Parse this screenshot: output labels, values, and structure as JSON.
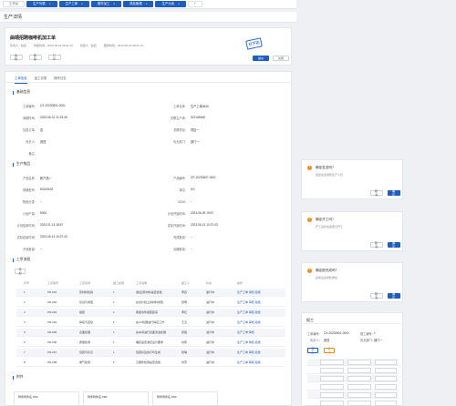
{
  "tabs": [
    {
      "label": "工作台",
      "active": false
    },
    {
      "label": "生产列表",
      "active": true
    },
    {
      "label": "生产工单",
      "active": true
    },
    {
      "label": "委外加工",
      "active": true
    },
    {
      "label": "质检管理",
      "active": true
    },
    {
      "label": "生产计划",
      "active": true
    }
  ],
  "tab_close": "×",
  "page_title": "生产详情",
  "header": {
    "title": "曲靖招聘咖啡机加工单",
    "meta": [
      "负责人：赵四",
      "创建时间：2023-05-01 09:41:12",
      "创建人：赵四",
      "更新时间：2023-05-01 09:41:12"
    ],
    "buttons": {
      "edit": "编辑",
      "delete": "删除",
      "print": "打印"
    },
    "stamp": "已下达",
    "submit": "提交",
    "close": "关闭"
  },
  "subtabs": [
    "工单信息",
    "加工记录",
    "操作日志"
  ],
  "basic": {
    "title": "基础信息",
    "fields": [
      {
        "label": "工单编号：",
        "value": "CX-20230601-0001"
      },
      {
        "label": "工单名称：",
        "value": "生产工单0640"
      },
      {
        "label": "单据时间：",
        "value": "2023-06-01 21:23:45"
      },
      {
        "label": "关联生产单：",
        "value": "SCD45568"
      },
      {
        "label": "加急订单：",
        "value": "否"
      },
      {
        "label": "关联项目：",
        "value": "项目一"
      },
      {
        "label": "负责人：",
        "value": "张四"
      },
      {
        "label": "负责部门：",
        "value": "部门一"
      },
      {
        "label": "备注：",
        "value": ""
      }
    ]
  },
  "product": {
    "title": "生产物品",
    "fields": [
      {
        "label": "产品名称：",
        "value": "新产品一"
      },
      {
        "label": "产品编号：",
        "value": "CP-20230607-0001"
      },
      {
        "label": "规格型号：",
        "value": "60100192"
      },
      {
        "label": "单位：",
        "value": "KG"
      },
      {
        "label": "物品分类：",
        "value": "--"
      },
      {
        "label": "BOM：",
        "value": "--"
      },
      {
        "label": "计划产量：",
        "value": "5000"
      },
      {
        "label": "计划开始时间：",
        "value": "2023-06-09 19:57"
      },
      {
        "label": "计划结束时间：",
        "value": "2023-01-14 18:57"
      },
      {
        "label": "实际开始时间：",
        "value": "2023-06-13 10:37:43"
      },
      {
        "label": "实际结束时间：",
        "value": "2023-06-13 10:37:43"
      },
      {
        "label": "完成数量：",
        "value": "--"
      },
      {
        "label": "不良数量：",
        "value": "--"
      },
      {
        "label": "合格数量：",
        "value": "--"
      }
    ]
  },
  "process": {
    "title": "工序流程",
    "add_btn": "添加",
    "columns": [
      "序号",
      "工序编号",
      "工序名称",
      "报工权限",
      "工序说明",
      "报工人",
      "状态",
      "操作"
    ],
    "rows": [
      {
        "no": "1",
        "code": "PR-001",
        "name": "原材料检验",
        "perm": "1",
        "desc": "[验证]原材料是否合格",
        "who": "李四",
        "status": "進行中",
        "ops": "生产工单 审核 拒绝"
      },
      {
        "no": "2",
        "code": "PR-002",
        "name": "切割与成型",
        "perm": "1",
        "desc": "在切片机上将材料成型",
        "who": "张明",
        "status": "进行中",
        "ops": "生产工单 审核 拒绝"
      },
      {
        "no": "3",
        "code": "PR-003",
        "name": "组装",
        "perm": "1",
        "desc": "把各零件组装起来",
        "who": "李红",
        "status": "进行中",
        "ops": "生产工单 审核 拒绝"
      },
      {
        "no": "4",
        "code": "PR-004",
        "name": "焊接与连接",
        "perm": "1",
        "desc": "在UV机器进行焊接工作",
        "who": "王五",
        "status": "进行中",
        "ops": "生产工单 审核 拒绝"
      },
      {
        "no": "5",
        "code": "PR-005",
        "name": "表面处理",
        "perm": "1",
        "desc": "在车间进行表面清洁处理",
        "who": "张强",
        "status": "进行中",
        "ops": "生产工单 审核"
      },
      {
        "no": "6",
        "code": "PR-006",
        "name": "质量检测",
        "perm": "1",
        "desc": "确定是否满足设计要求",
        "who": "刘伟",
        "status": "进行中",
        "ops": "生产工单 审核 拒绝"
      },
      {
        "no": "7",
        "code": "PR-007",
        "name": "包装与标记",
        "perm": "1",
        "desc": "包装标签的打印生成",
        "who": "张琳",
        "status": "进行中",
        "ops": "生产工单 审核 拒绝"
      },
      {
        "no": "8",
        "code": "PR-008",
        "name": "电气检测",
        "perm": "1",
        "desc": "元器件检测是否合格",
        "who": "刘芳",
        "status": "进行中",
        "ops": "生产工单 审核 拒绝"
      }
    ]
  },
  "attachments": {
    "title": "附件",
    "files": [
      "附件附件名.PDF",
      "附件附件名.PDF",
      "附件附件名.PDF"
    ]
  },
  "dialogs": [
    {
      "question": "确定发送吗？",
      "desc": "发送后会通知生产人员",
      "cancel": "取消",
      "ok": "确定"
    },
    {
      "question": "确定开工吗？",
      "desc": "开工后状态变更为开工",
      "cancel": "取消",
      "ok": "确定"
    },
    {
      "question": "确定报完成吗？",
      "desc": "完成后会通知质检",
      "cancel": "取消",
      "ok": "确定"
    }
  ],
  "side": {
    "title": "报工",
    "fields": [
      {
        "label": "工单编号：",
        "value": "CX-20230601-0001"
      },
      {
        "label": "报工编号：",
        "value": "1"
      },
      {
        "label": "负责人：",
        "value": "张四"
      },
      {
        "label": "负责部门：",
        "value": "部门一"
      }
    ],
    "btn1": "报工",
    "btn2": "取消"
  },
  "colors": {
    "accent": "#1e5fbd",
    "warn": "#f08c1a"
  }
}
